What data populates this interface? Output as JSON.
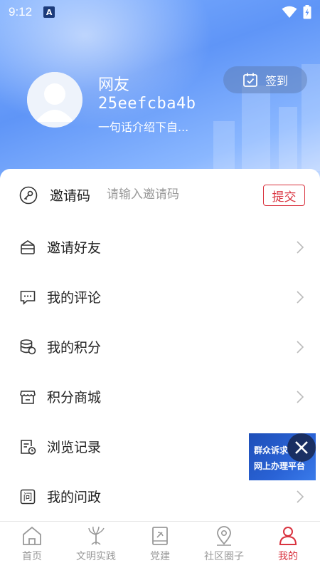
{
  "status_bar": {
    "time": "9:12",
    "notification_badge": "A"
  },
  "profile": {
    "name": "网友",
    "user_id": "25eefcba4b",
    "bio": "一句话介绍下自..."
  },
  "checkin": {
    "label": "签到",
    "icon": "calendar-check-icon"
  },
  "invite_code": {
    "label": "邀请码",
    "placeholder": "请输入邀请码",
    "value": "",
    "submit_label": "提交",
    "icon": "key-icon"
  },
  "menu": [
    {
      "label": "邀请好友",
      "icon": "invite-envelope-icon"
    },
    {
      "label": "我的评论",
      "icon": "comment-icon"
    },
    {
      "label": "我的积分",
      "icon": "coins-icon"
    },
    {
      "label": "积分商城",
      "icon": "store-icon"
    },
    {
      "label": "浏览记录",
      "icon": "history-icon"
    },
    {
      "label": "我的问政",
      "icon": "inquiry-icon"
    }
  ],
  "float_banner": {
    "line1": "群众诉求",
    "line2": "网上办理平台"
  },
  "tabs": [
    {
      "label": "首页",
      "icon": "home-icon",
      "active": false
    },
    {
      "label": "文明实践",
      "icon": "civilization-icon",
      "active": false
    },
    {
      "label": "党建",
      "icon": "party-book-icon",
      "active": false
    },
    {
      "label": "社区圈子",
      "icon": "location-pin-icon",
      "active": false
    },
    {
      "label": "我的",
      "icon": "person-icon",
      "active": true
    }
  ],
  "colors": {
    "accent": "#d9333f",
    "header_blue": "#5f95f7",
    "muted": "#999999"
  }
}
